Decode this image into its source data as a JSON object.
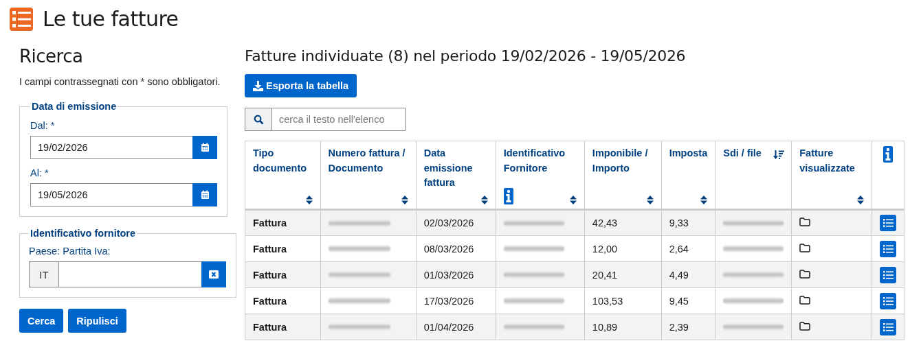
{
  "page_title": "Le tue fatture",
  "search": {
    "title": "Ricerca",
    "note": "I campi contrassegnati con * sono obbligatori.",
    "date_group": {
      "legend": "Data di emissione",
      "fields": [
        {
          "label": "Dal: *",
          "value": "19/02/2026"
        },
        {
          "label": "Al: *",
          "value": "19/05/2026"
        }
      ]
    },
    "supplier_group": {
      "legend": "Identificativo fornitore",
      "label": "Paese: Partita Iva:",
      "country": "IT"
    },
    "buttons": [
      "Cerca",
      "Ripulisci"
    ]
  },
  "results": {
    "title": "Fatture individuate (8) nel periodo 19/02/2026 - 19/05/2026",
    "export_button": "Esporta la tabella",
    "filter": {
      "placeholder": "cerca il testo nell'elenco"
    },
    "table": {
      "columns": [
        {
          "label": "Tipo documento",
          "sorted": false
        },
        {
          "label": "Numero fattura / Documento",
          "sorted": false
        },
        {
          "label": "Data emissione fattura",
          "sorted": false
        },
        {
          "label": "Identificativo Fornitore",
          "sorted": false,
          "info": true
        },
        {
          "label": "Imponibile / Importo",
          "sorted": false
        },
        {
          "label": "Imposta",
          "sorted": false
        },
        {
          "label": "Sdi / file",
          "sorted": true
        },
        {
          "label": "Fatture visualizzate",
          "sorted": false
        },
        {
          "kind": "info"
        }
      ],
      "rows": [
        {
          "type": "Fattura",
          "date": "02/03/2026",
          "amount": "42,43",
          "tax": "9,33"
        },
        {
          "type": "Fattura",
          "date": "08/03/2026",
          "amount": "12,00",
          "tax": "2,64"
        },
        {
          "type": "Fattura",
          "date": "01/03/2026",
          "amount": "20,41",
          "tax": "4,49"
        },
        {
          "type": "Fattura",
          "date": "17/03/2026",
          "amount": "103,53",
          "tax": "9,45"
        },
        {
          "type": "Fattura",
          "date": "01/04/2026",
          "amount": "10,89",
          "tax": "2,39"
        }
      ]
    }
  }
}
